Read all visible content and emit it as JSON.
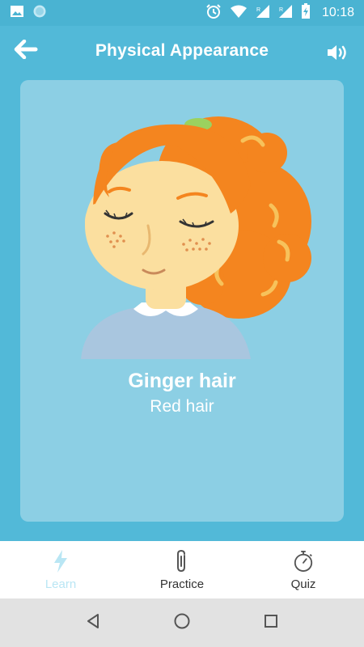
{
  "status_bar": {
    "time": "10:18",
    "icons": [
      "image-icon",
      "circle-notification-icon",
      "alarm-icon",
      "wifi-icon",
      "signal-r-icon",
      "signal-r-icon",
      "battery-charging-icon"
    ]
  },
  "header": {
    "title": "Physical Appearance",
    "back_icon": "back-arrow-icon",
    "sound_icon": "speaker-icon"
  },
  "card": {
    "word": "Ginger hair",
    "translation": "Red hair",
    "illustration": "girl-with-ginger-curly-hair"
  },
  "bottom_nav": {
    "items": [
      {
        "label": "Learn",
        "icon": "lightning-icon",
        "active": true
      },
      {
        "label": "Practice",
        "icon": "paperclip-icon",
        "active": false
      },
      {
        "label": "Quiz",
        "icon": "stopwatch-icon",
        "active": false
      }
    ]
  },
  "system_nav": {
    "items": [
      "back-triangle-icon",
      "home-circle-icon",
      "recents-square-icon"
    ]
  },
  "colors": {
    "background": "#52b9d8",
    "card": "#8ccfe4",
    "hair": "#f4851f",
    "skin": "#fbdf9f",
    "active_tab": "#b9e6f4"
  }
}
